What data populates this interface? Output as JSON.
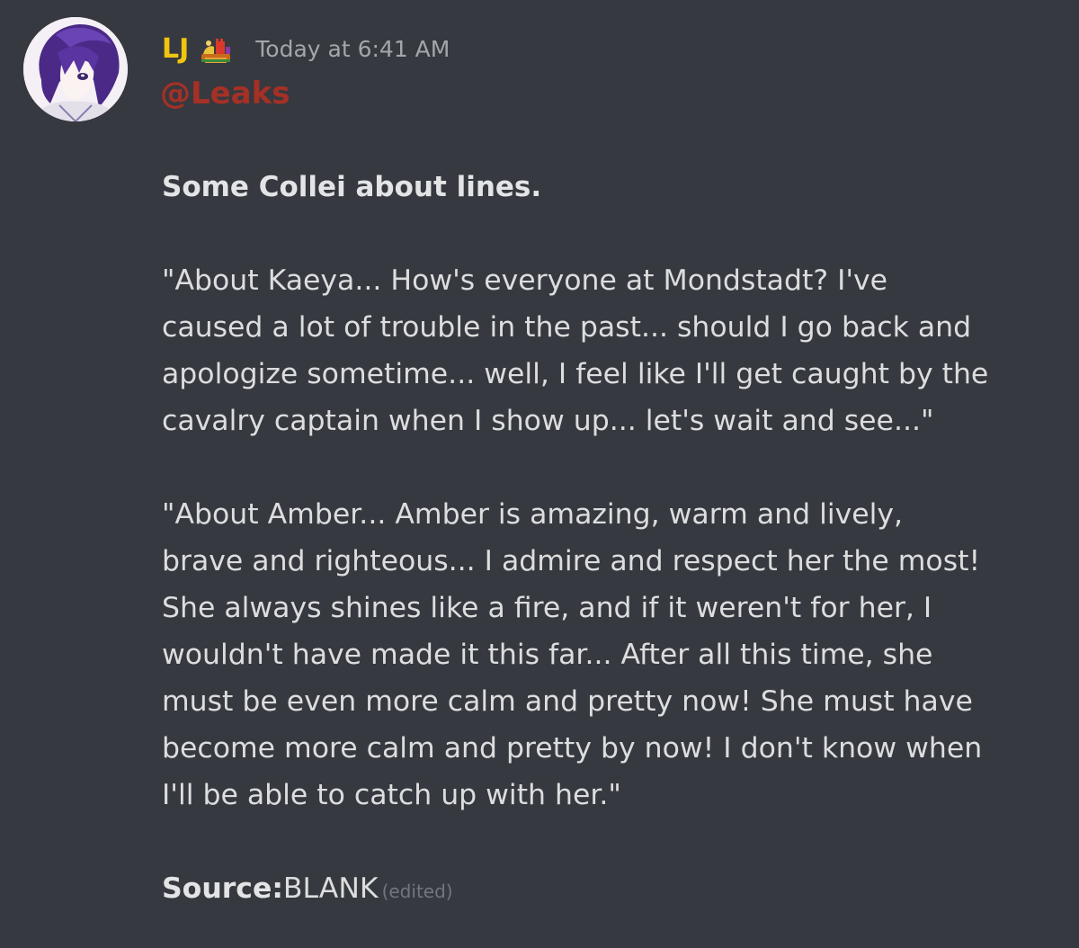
{
  "message": {
    "author": "LJ",
    "badge_icon": "trophy-castle-icon",
    "timestamp": "Today at 6:41 AM",
    "mention": "@Leaks",
    "heading": "Some Collei about lines.",
    "paragraph1_lines": [
      "\"About Kaeya... How's everyone at Mondstadt? I've",
      "caused a lot of trouble in the past... should I go back and",
      "apologize sometime... well, I feel like I'll get caught by the",
      "cavalry captain when I show up... let's wait and see...\""
    ],
    "paragraph2_lines": [
      "\"About Amber... Amber is amazing, warm and lively,",
      "brave and righteous... I admire and respect her the most!",
      "She always shines like a fire, and if it weren't for her, I",
      "wouldn't have made it this far... After all this time, she",
      "must be even more calm and pretty now! She must have",
      "become more calm and pretty by now! I don't know when",
      "I'll be able to catch up with her.\""
    ],
    "source_label": "Source:",
    "source_value": "BLANK",
    "edited_label": "(edited)"
  },
  "colors": {
    "background": "#36393f",
    "username": "#f1c40f",
    "mention": "#a53026",
    "text": "#dcddde",
    "muted": "#a3a6aa"
  }
}
